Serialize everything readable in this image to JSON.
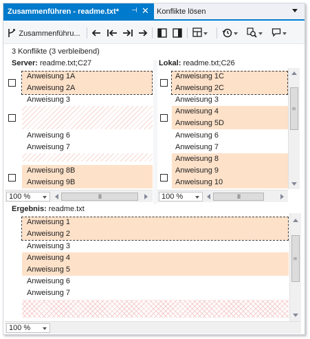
{
  "tabs": {
    "active_label": "Zusammenführen - readme.txt*",
    "pin": "⊣",
    "close": "✕",
    "other_label": "Konflikte lösen"
  },
  "toolbar": {
    "merge_label": "Zusammenführu...",
    "icons": [
      "merge-icon",
      "arrow-left-icon",
      "first-conflict-icon",
      "last-conflict-icon",
      "arrow-right-icon",
      "split-left-icon",
      "split-right-icon",
      "layout-icon",
      "history-icon",
      "compare-icon",
      "comment-icon"
    ]
  },
  "summary": "3 Konflikte (3 verbleibend)",
  "server": {
    "title_bold": "Server:",
    "title_file": " readme.txt;C27",
    "lines": [
      "Anweisung 1A",
      "Anweisung 2A",
      "Anweisung 3",
      "Anweisung 6",
      "Anweisung 7",
      "Anweisung 8B",
      "Anweisung 9B"
    ],
    "zoom": "100 %"
  },
  "local": {
    "title_bold": "Lokal:",
    "title_file": " readme.txt;C26",
    "lines": [
      "Anweisung 1C",
      "Anweisung 2C",
      "Anweisung 3",
      "Anweisung 4",
      "Anweisung 5D",
      "Anweisung 6",
      "Anweisung 7",
      "Anweisung 8",
      "Anweisung 9",
      "Anweisung 10"
    ],
    "zoom": "100 %"
  },
  "result": {
    "title_bold": "Ergebnis:",
    "title_file": " readme.txt",
    "lines": [
      "Anweisung 1",
      "Anweisung 2",
      "Anweisung 3",
      "Anweisung 4",
      "Anweisung 5",
      "Anweisung 6",
      "Anweisung 7"
    ],
    "zoom": "100 %"
  },
  "colors": {
    "accent": "#007acc",
    "conflict_fill": "#fde1c9",
    "hatch": "#f7d5cd"
  }
}
